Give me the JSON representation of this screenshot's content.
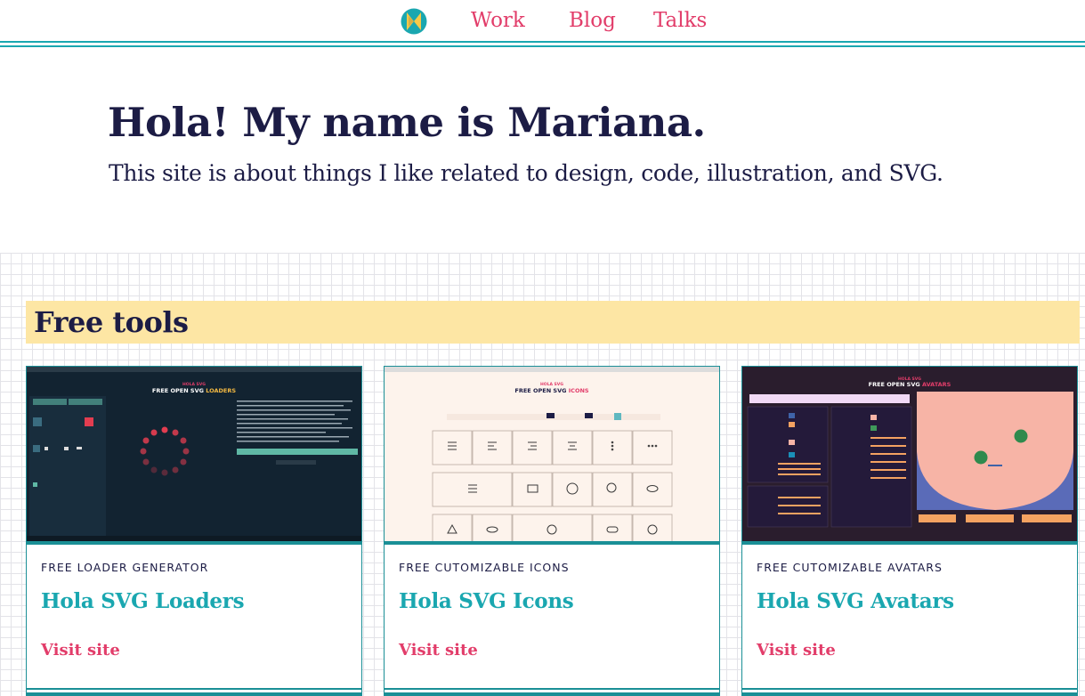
{
  "nav": {
    "logo": "hola-logo-icon",
    "links": [
      "Work",
      "Blog",
      "Talks"
    ]
  },
  "hero": {
    "title": "Hola! My name is Mariana.",
    "subtitle": "This site is about things I like related to design, code, illustration, and SVG."
  },
  "tools": {
    "heading": "Free tools",
    "cards": [
      {
        "eyebrow": "FREE LOADER GENERATOR",
        "title": "Hola SVG Loaders",
        "link": "Visit site",
        "screenshot": {
          "brand": "HOLA SVG",
          "headline": "FREE OPEN SVG",
          "accent": "LOADERS"
        }
      },
      {
        "eyebrow": "FREE CUTOMIZABLE ICONS",
        "title": "Hola SVG Icons",
        "link": "Visit site",
        "screenshot": {
          "brand": "HOLA SVG",
          "headline": "FREE OPEN SVG",
          "accent": "ICONS"
        }
      },
      {
        "eyebrow": "FREE CUTOMIZABLE AVATARS",
        "title": "Hola SVG Avatars",
        "link": "Visit site",
        "screenshot": {
          "brand": "HOLA SVG",
          "headline": "FREE OPEN SVG",
          "accent": "AVATARS"
        }
      }
    ]
  },
  "colors": {
    "accent_pink": "#e23d6a",
    "accent_teal": "#1aa7b0",
    "text_navy": "#1c1c45",
    "highlight_yellow": "#fde6a4"
  }
}
